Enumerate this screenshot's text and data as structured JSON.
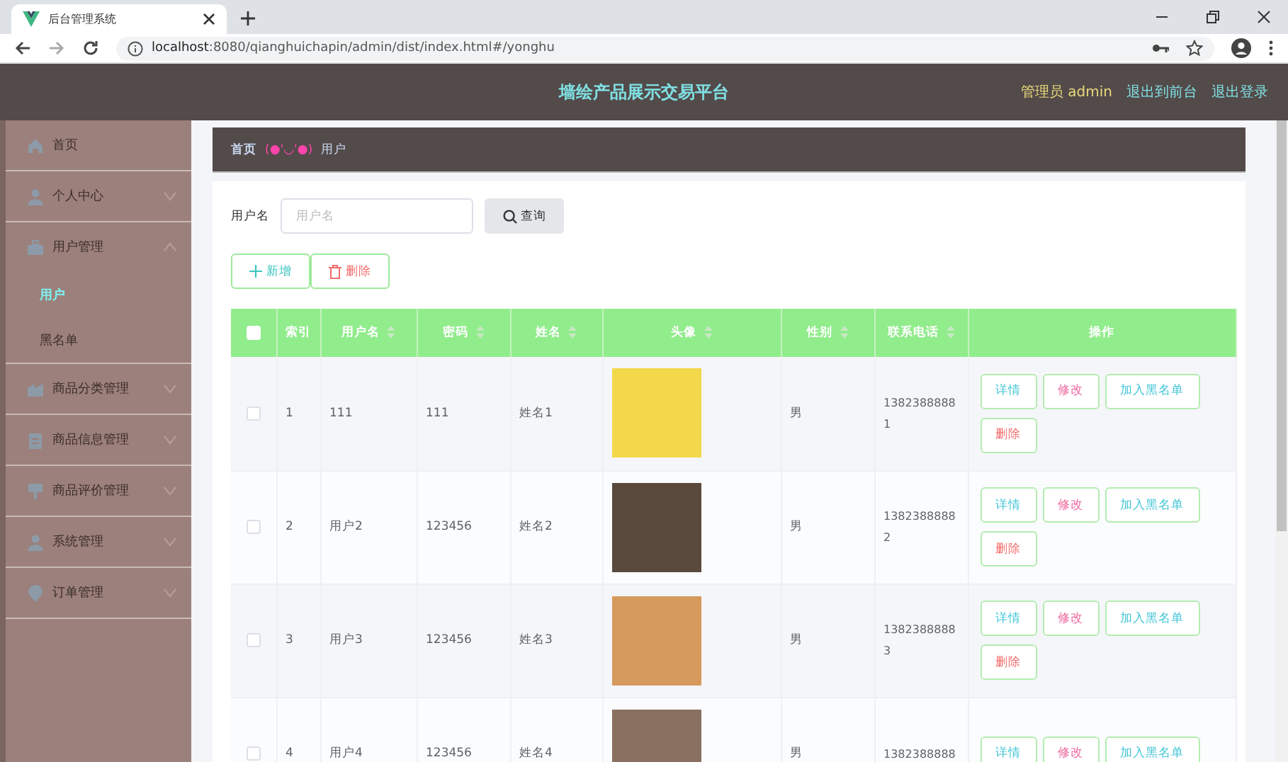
{
  "browser": {
    "tab_title": "后台管理系统",
    "url_host": "localhost",
    "url_rest": ":8080/qianghuichapin/admin/dist/index.html#/yonghu"
  },
  "header": {
    "title": "墙绘产品展示交易平台",
    "user": "管理员 admin",
    "links": [
      "退出到前台",
      "退出登录"
    ]
  },
  "sidebar": {
    "items": [
      {
        "label": "首页",
        "expanded": false,
        "has_children": false
      },
      {
        "label": "个人中心",
        "expanded": false,
        "has_children": true
      },
      {
        "label": "用户管理",
        "expanded": true,
        "has_children": true,
        "children": [
          {
            "label": "用户",
            "selected": true
          },
          {
            "label": "黑名单",
            "selected": false
          }
        ]
      },
      {
        "label": "商品分类管理",
        "expanded": false,
        "has_children": true
      },
      {
        "label": "商品信息管理",
        "expanded": false,
        "has_children": true
      },
      {
        "label": "商品评价管理",
        "expanded": false,
        "has_children": true
      },
      {
        "label": "系统管理",
        "expanded": false,
        "has_children": true
      },
      {
        "label": "订单管理",
        "expanded": false,
        "has_children": true
      }
    ]
  },
  "breadcrumb": {
    "home": "首页",
    "separator": "(●'◡'●)",
    "current": "用户"
  },
  "search": {
    "label": "用户名",
    "placeholder": "用户名",
    "button": "查询"
  },
  "actions": [
    {
      "label": "新增",
      "kind": "add"
    },
    {
      "label": "删除",
      "kind": "delete"
    }
  ],
  "table": {
    "header_checked": false,
    "columns": [
      {
        "label": "索引",
        "sortable": false
      },
      {
        "label": "用户名",
        "sortable": true
      },
      {
        "label": "密码",
        "sortable": true
      },
      {
        "label": "姓名",
        "sortable": true
      },
      {
        "label": "头像",
        "sortable": true
      },
      {
        "label": "性别",
        "sortable": true
      },
      {
        "label": "联系电话",
        "sortable": true
      },
      {
        "label": "操作",
        "sortable": false
      }
    ],
    "rows": [
      {
        "checked": false,
        "index": "1",
        "username": "111",
        "password": "111",
        "name": "姓名1",
        "gender": "男",
        "phone": "13823888881",
        "buttons": [
          "详情",
          "修改",
          "加入黑名单",
          "删除"
        ]
      },
      {
        "checked": false,
        "index": "2",
        "username": "用户2",
        "password": "123456",
        "name": "姓名2",
        "gender": "男",
        "phone": "13823888882",
        "buttons": [
          "详情",
          "修改",
          "加入黑名单",
          "删除"
        ]
      },
      {
        "checked": false,
        "index": "3",
        "username": "用户3",
        "password": "123456",
        "name": "姓名3",
        "gender": "男",
        "phone": "13823888883",
        "buttons": [
          "详情",
          "修改",
          "加入黑名单",
          "删除"
        ]
      },
      {
        "checked": false,
        "index": "4",
        "username": "用户4",
        "password": "123456",
        "name": "姓名4",
        "gender": "男",
        "phone": "1382388888",
        "buttons": [
          "详情",
          "修改",
          "加入黑名单"
        ]
      }
    ]
  }
}
